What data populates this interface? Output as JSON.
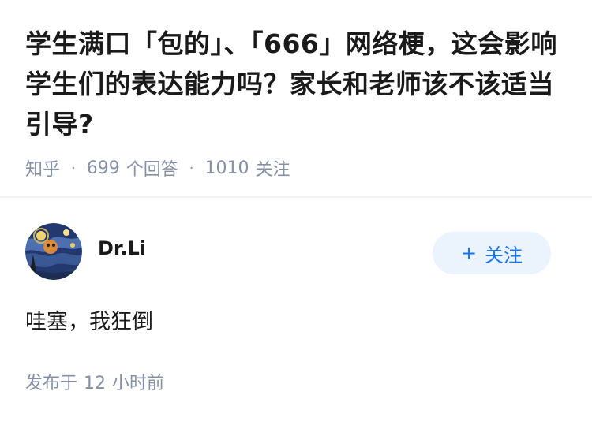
{
  "question": {
    "title": "学生满口「包的」、「666」网络梗，这会影响学生们的表达能力吗？家长和老师该不该适当引导?",
    "meta": {
      "source": "知乎",
      "separator": "·",
      "answer_count": "699",
      "answer_label": "个回答",
      "follow_count": "1010",
      "follow_label": "关注"
    }
  },
  "answer": {
    "author": {
      "name": "Dr.Li",
      "avatar_icon": "starry-night-avatar"
    },
    "follow_button": {
      "plus": "+",
      "label": "关注"
    },
    "content": "哇塞，我狂倒",
    "time": {
      "prefix": "发布于",
      "value": "12",
      "suffix": "小时前"
    }
  },
  "colors": {
    "title": "#1a1a1a",
    "meta": "#8590a6",
    "accent": "#1772f6",
    "follow_bg": "#ebf4fc"
  }
}
